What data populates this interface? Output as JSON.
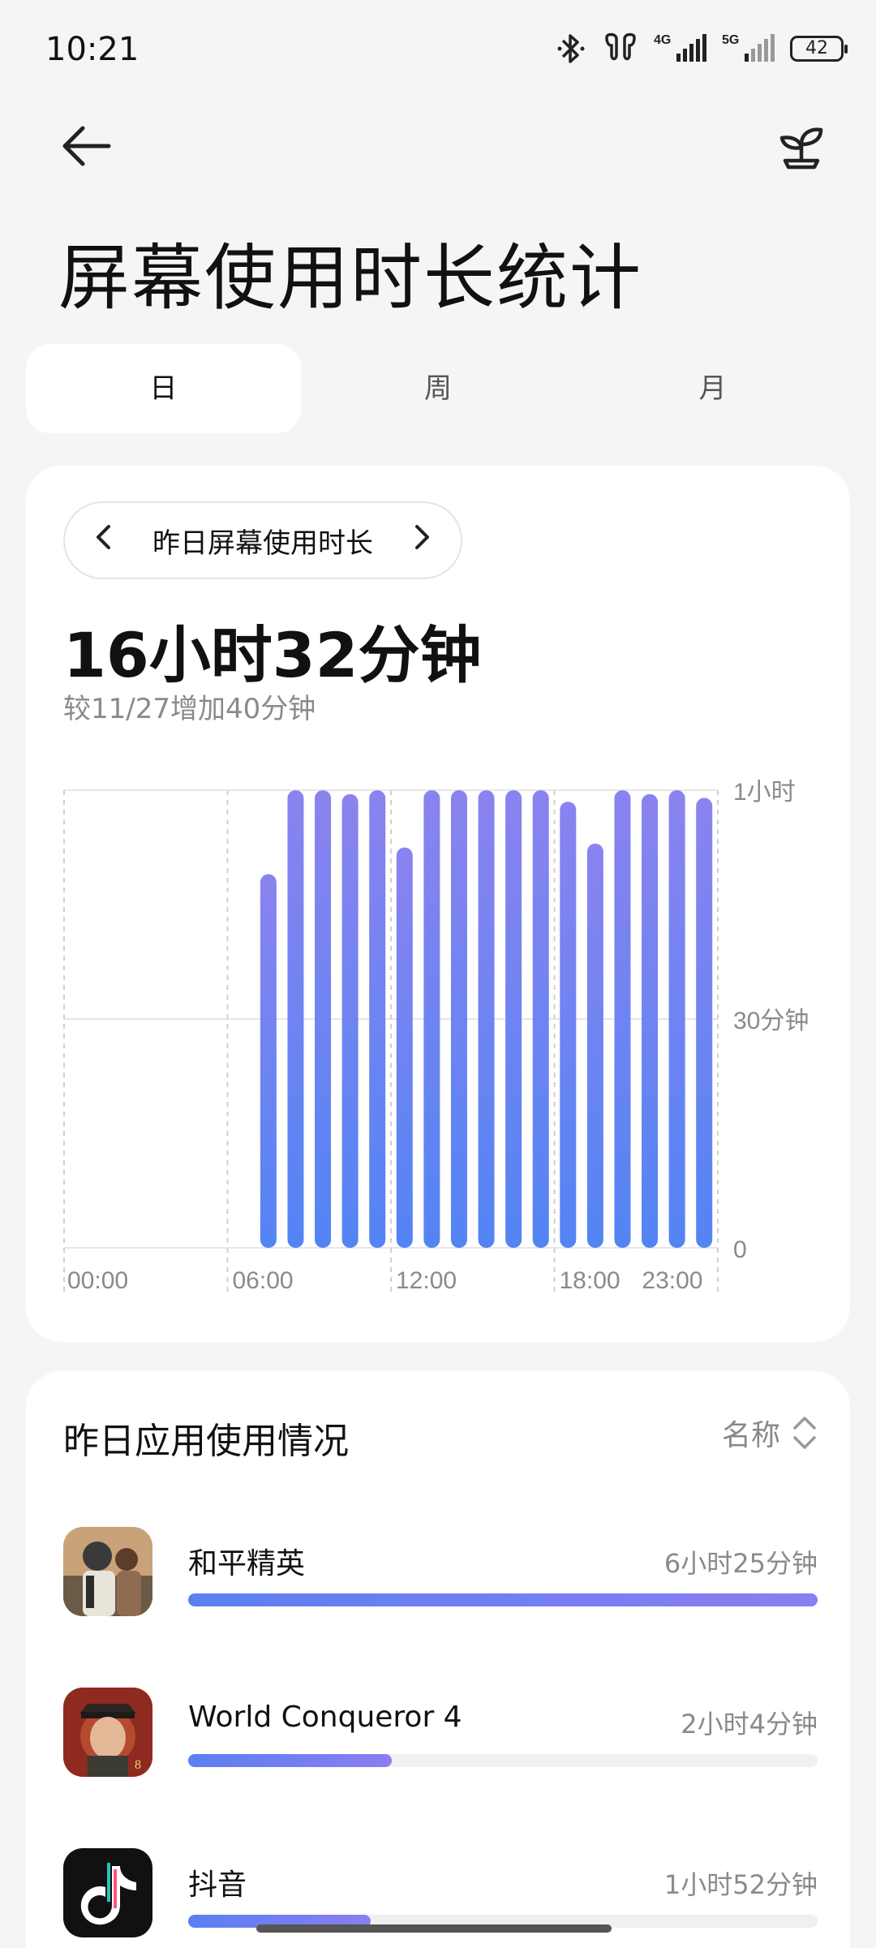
{
  "status_bar": {
    "time": "10:21",
    "battery": "42",
    "network_labels": [
      "4G",
      "5G"
    ]
  },
  "nav": {
    "back_icon": "arrow-left-icon",
    "right_icon": "sprout-icon"
  },
  "page_title": "屏幕使用时长统计",
  "tabs": [
    {
      "label": "日",
      "active": true
    },
    {
      "label": "周",
      "active": false
    },
    {
      "label": "月",
      "active": false
    }
  ],
  "summary": {
    "date_label": "昨日屏幕使用时长",
    "total": "16小时32分钟",
    "compare": "较11/27增加40分钟"
  },
  "chart_data": {
    "type": "bar",
    "categories": [
      "07:00",
      "08:00",
      "09:00",
      "10:00",
      "11:00",
      "12:00",
      "13:00",
      "14:00",
      "15:00",
      "16:00",
      "17:00",
      "18:00",
      "19:00",
      "20:00",
      "21:00",
      "22:00",
      "23:00"
    ],
    "values": [
      49,
      60,
      60,
      59.5,
      60,
      52.5,
      60,
      60,
      60,
      60,
      60,
      58.5,
      53,
      60,
      59.5,
      60,
      59
    ],
    "x_tick_labels": [
      "00:00",
      "06:00",
      "12:00",
      "18:00",
      "23:00"
    ],
    "y_tick_labels": [
      "1小时",
      "30分钟",
      "0"
    ],
    "ylim": [
      0,
      60
    ],
    "y_unit": "minutes",
    "gradient_colors": [
      "#8a83ef",
      "#5384f4"
    ]
  },
  "apps": {
    "title": "昨日应用使用情况",
    "sort_label": "名称",
    "items": [
      {
        "name": "和平精英",
        "time": "6小时25分钟",
        "fraction": 1.0,
        "icon": "peace-elite-icon"
      },
      {
        "name": "World Conqueror 4",
        "time": "2小时4分钟",
        "fraction": 0.323,
        "icon": "world-conqueror-icon"
      },
      {
        "name": "抖音",
        "time": "1小时52分钟",
        "fraction": 0.29,
        "icon": "douyin-icon"
      }
    ]
  }
}
